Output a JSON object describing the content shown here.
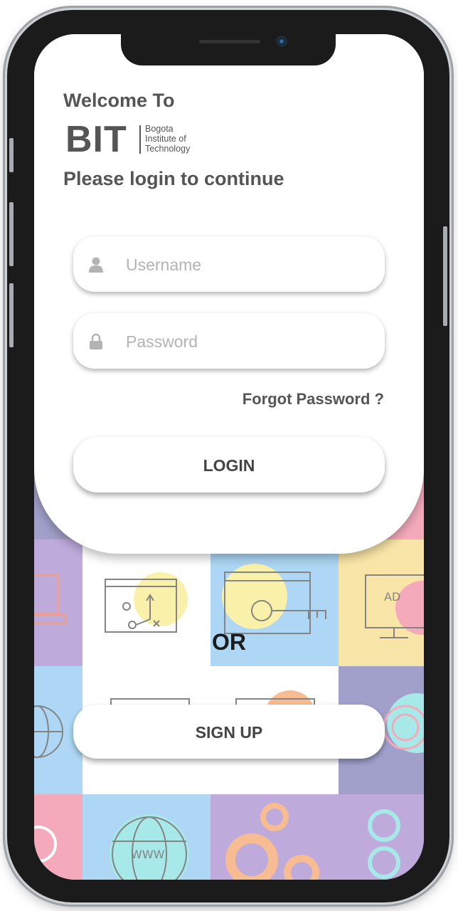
{
  "header": {
    "welcome": "Welcome To",
    "logo_mark": "BIT",
    "logo_lines": [
      "Bogota",
      "Institute of",
      "Technology"
    ],
    "subtitle": "Please login to continue"
  },
  "form": {
    "username": {
      "placeholder": "Username",
      "value": "",
      "icon": "user-icon"
    },
    "password": {
      "placeholder": "Password",
      "value": "",
      "icon": "lock-icon"
    },
    "forgot_label": "Forgot Password ?",
    "login_label": "LOGIN"
  },
  "divider": {
    "or_label": "OR"
  },
  "signup": {
    "label": "SIGN UP"
  },
  "background": {
    "description_icons": [
      "plan-icon",
      "key-icon",
      "ad-monitor-icon",
      "globe-www-icon",
      "gears-icon",
      "fingerprint-icon",
      "laptop-icon"
    ],
    "colors": {
      "blue": "#8ec8f0",
      "yellow": "#f7dc86",
      "purple": "#a58bcf",
      "indigo": "#7c7cb8",
      "pink": "#f28aa2",
      "orange": "#f6a36a",
      "teal": "#86e0df"
    }
  }
}
